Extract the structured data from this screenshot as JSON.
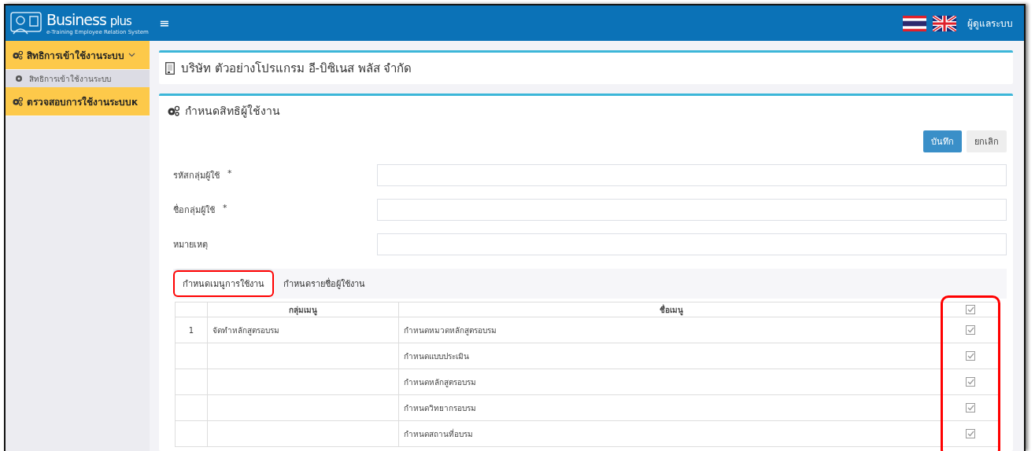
{
  "topbar": {
    "brand": "Business",
    "brand_suffix": "plus",
    "tagline": "e-Training Employee Relation System",
    "menu_glyph": "≡",
    "user": "ผู้ดูแลระบบ"
  },
  "sidebar": {
    "items": [
      {
        "label": "สิทธิการเข้าใช้งานระบบ",
        "expanded": true,
        "children": [
          {
            "label": "สิทธิการเข้าใช้งานระบบ",
            "selected": true
          }
        ]
      },
      {
        "label": "ตรวจสอบการใช้งานระบบк",
        "expanded": false
      }
    ]
  },
  "company": {
    "name": "บริษัท ตัวอย่างโปรแกรม อี-บิซิเนส พลัส จำกัด"
  },
  "panel": {
    "title": "กำหนดสิทธิผู้ใช้งาน",
    "buttons": [
      {
        "label": "บันทึก",
        "kind": "primary"
      },
      {
        "label": "ยกเลิก",
        "kind": "secondary"
      }
    ],
    "fields": [
      {
        "label": "รหัสกลุ่มผู้ใช้",
        "marker": "*"
      },
      {
        "label": "ชื่อกลุ่มผู้ใช้",
        "marker": "*"
      },
      {
        "label": "หมายเหตุ"
      }
    ],
    "tabs": [
      {
        "label": "กำหนดเมนูการใช้งาน",
        "selected": true,
        "highlighted": true
      },
      {
        "label": "กำหนดรายชื่อผู้ใช้งาน",
        "selected": false,
        "highlighted": false
      }
    ],
    "table": {
      "columns": [
        "กลุ่มเมนู",
        "ชื่อเมนู"
      ],
      "header_checked": true,
      "check_column_highlighted": true,
      "rows": [
        {
          "number": "1",
          "group": "จัดทำหลักสูตรอบรม",
          "menu": "กำหนดหมวดหลักสูตรอบรม",
          "checked": true
        },
        {
          "menu": "กำหนดแบบประเมิน",
          "checked": true
        },
        {
          "menu": "กำหนดหลักสูตรอบรม",
          "checked": true
        },
        {
          "menu": "กำหนดวิทยากรอบรม",
          "checked": true
        },
        {
          "menu": "กำหนดสถานที่อบรม",
          "checked": true
        }
      ]
    }
  }
}
